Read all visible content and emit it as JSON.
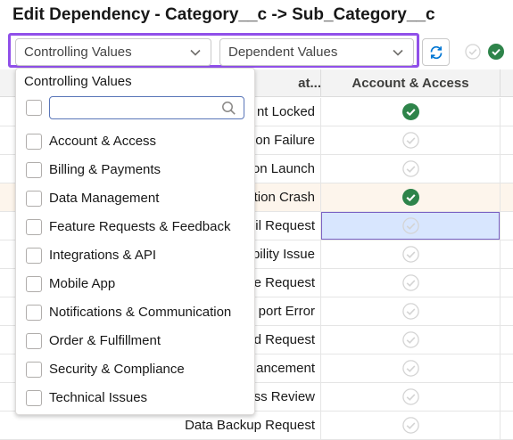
{
  "page": {
    "title": "Edit Dependency - Category__c -> Sub_Category__c"
  },
  "toolbar": {
    "controlling_label": "Controlling Values",
    "dependent_label": "Dependent Values",
    "colors": {
      "accent": "#9050e9",
      "success": "#2e844a",
      "brand": "#0176d3"
    }
  },
  "grid": {
    "header": {
      "col1": "Subcat...",
      "col1_visible": "at...",
      "col2": "Account & Access"
    },
    "rows": [
      {
        "label": "nt Locked",
        "checked": true,
        "highlight": false,
        "selected": false
      },
      {
        "label": "on Failure",
        "checked": false,
        "highlight": false,
        "selected": false
      },
      {
        "label": "on Launch",
        "checked": false,
        "highlight": false,
        "selected": false
      },
      {
        "label": "tion Crash",
        "checked": true,
        "highlight": true,
        "selected": false
      },
      {
        "label": "il Request",
        "checked": false,
        "highlight": false,
        "selected": true
      },
      {
        "label": "bility Issue",
        "checked": false,
        "highlight": false,
        "selected": false
      },
      {
        "label": "e Request",
        "checked": false,
        "highlight": false,
        "selected": false
      },
      {
        "label": "port Error",
        "checked": false,
        "highlight": false,
        "selected": false
      },
      {
        "label": "d Request",
        "checked": false,
        "highlight": false,
        "selected": false
      },
      {
        "label": "ancement",
        "checked": false,
        "highlight": false,
        "selected": false
      },
      {
        "label": "ss Review",
        "checked": false,
        "highlight": false,
        "selected": false
      },
      {
        "label": "Data Backup Request",
        "checked": false,
        "highlight": false,
        "selected": false
      }
    ]
  },
  "dropdown": {
    "title": "Controlling Values",
    "search_value": "",
    "items": [
      "Account & Access",
      "Billing & Payments",
      "Data Management",
      "Feature Requests & Feedback",
      "Integrations & API",
      "Mobile App",
      "Notifications & Communication",
      "Order & Fulfillment",
      "Security & Compliance",
      "Technical Issues"
    ]
  }
}
